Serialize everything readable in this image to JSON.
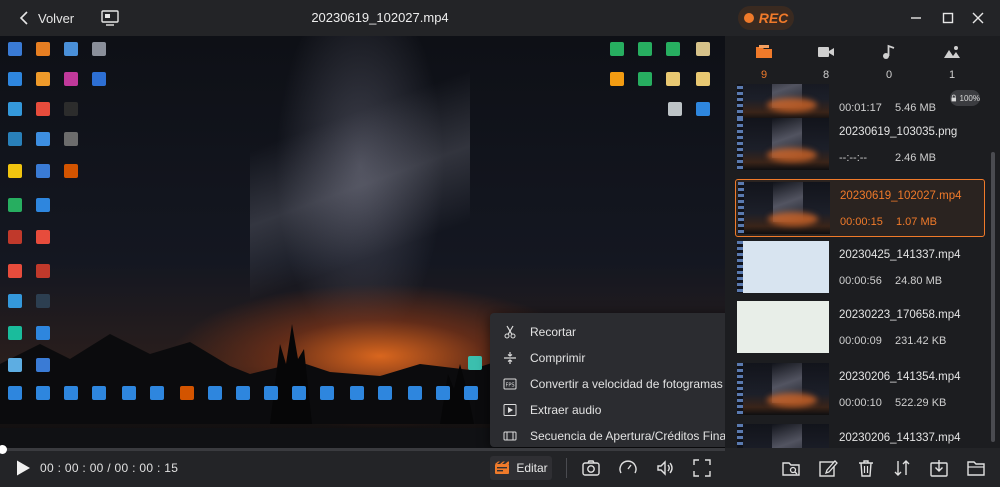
{
  "titlebar": {
    "back_label": "Volver",
    "file_title": "20230619_102027.mp4",
    "rec_label": "REC"
  },
  "context_menu": {
    "items": [
      {
        "label": "Recortar",
        "icon": "scissors-icon"
      },
      {
        "label": "Comprimir",
        "icon": "compress-icon"
      },
      {
        "label": "Convertir a velocidad de fotogramas constante",
        "icon": "fps-icon"
      },
      {
        "label": "Extraer audio",
        "icon": "extract-audio-icon"
      },
      {
        "label": "Secuencia de Apertura/Créditos Finales",
        "icon": "intro-outro-icon"
      }
    ]
  },
  "controls": {
    "time": "00 : 00 : 00 / 00 : 00 : 15",
    "edit_label": "Editar",
    "progress": 0
  },
  "categories": [
    {
      "icon": "folder-icon",
      "count": "9"
    },
    {
      "icon": "video-icon",
      "count": "8"
    },
    {
      "icon": "audio-icon",
      "count": "0"
    },
    {
      "icon": "image-icon",
      "count": "1"
    }
  ],
  "files": [
    {
      "name": "",
      "duration": "00:01:17",
      "size": "5.46 MB"
    },
    {
      "name": "20230619_103035.png",
      "duration": "--:--:--",
      "size": "2.46 MB"
    },
    {
      "name": "20230619_102027.mp4",
      "duration": "00:00:15",
      "size": "1.07 MB"
    },
    {
      "name": "20230425_141337.mp4",
      "duration": "00:00:56",
      "size": "24.80 MB"
    },
    {
      "name": "20230223_170658.mp4",
      "duration": "00:00:09",
      "size": "231.42 KB"
    },
    {
      "name": "20230206_141354.mp4",
      "duration": "00:00:10",
      "size": "522.29 KB"
    },
    {
      "name": "20230206_141337.mp4",
      "duration": "",
      "size": ""
    }
  ],
  "speed_badge": "100%",
  "colors": {
    "accent": "#f07a2a",
    "background": "#1f2023"
  }
}
